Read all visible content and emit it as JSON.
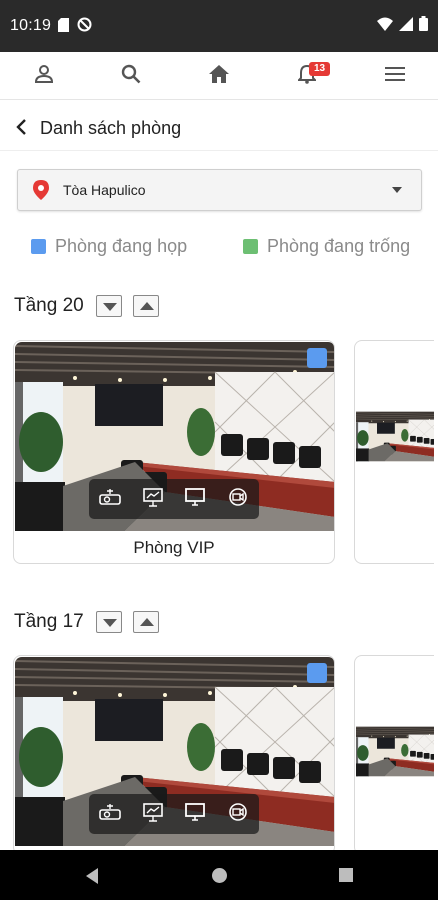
{
  "status_bar": {
    "time": "10:19"
  },
  "nav": {
    "notification_count": "13"
  },
  "header": {
    "title": "Danh sách phòng"
  },
  "building_select": {
    "value": "Tòa Hapulico"
  },
  "legend": [
    {
      "label": "Phòng đang họp",
      "color": "#5b9bef"
    },
    {
      "label": "Phòng đang trống",
      "color": "#6dbf73"
    }
  ],
  "floors": [
    {
      "title": "Tầng 20",
      "rooms": [
        {
          "name": "Phòng VIP",
          "status_color": "#5b9bef"
        }
      ]
    },
    {
      "title": "Tầng 17",
      "rooms": [
        {
          "name": "",
          "status_color": "#5b9bef"
        }
      ]
    }
  ],
  "amenity_icons": [
    "projector-icon",
    "presentation-board-icon",
    "monitor-icon",
    "video-conference-icon"
  ],
  "colors": {
    "status_bar": "#2a2a2a",
    "accent_red": "#e53935",
    "meeting": "#5b9bef",
    "free": "#6dbf73"
  }
}
